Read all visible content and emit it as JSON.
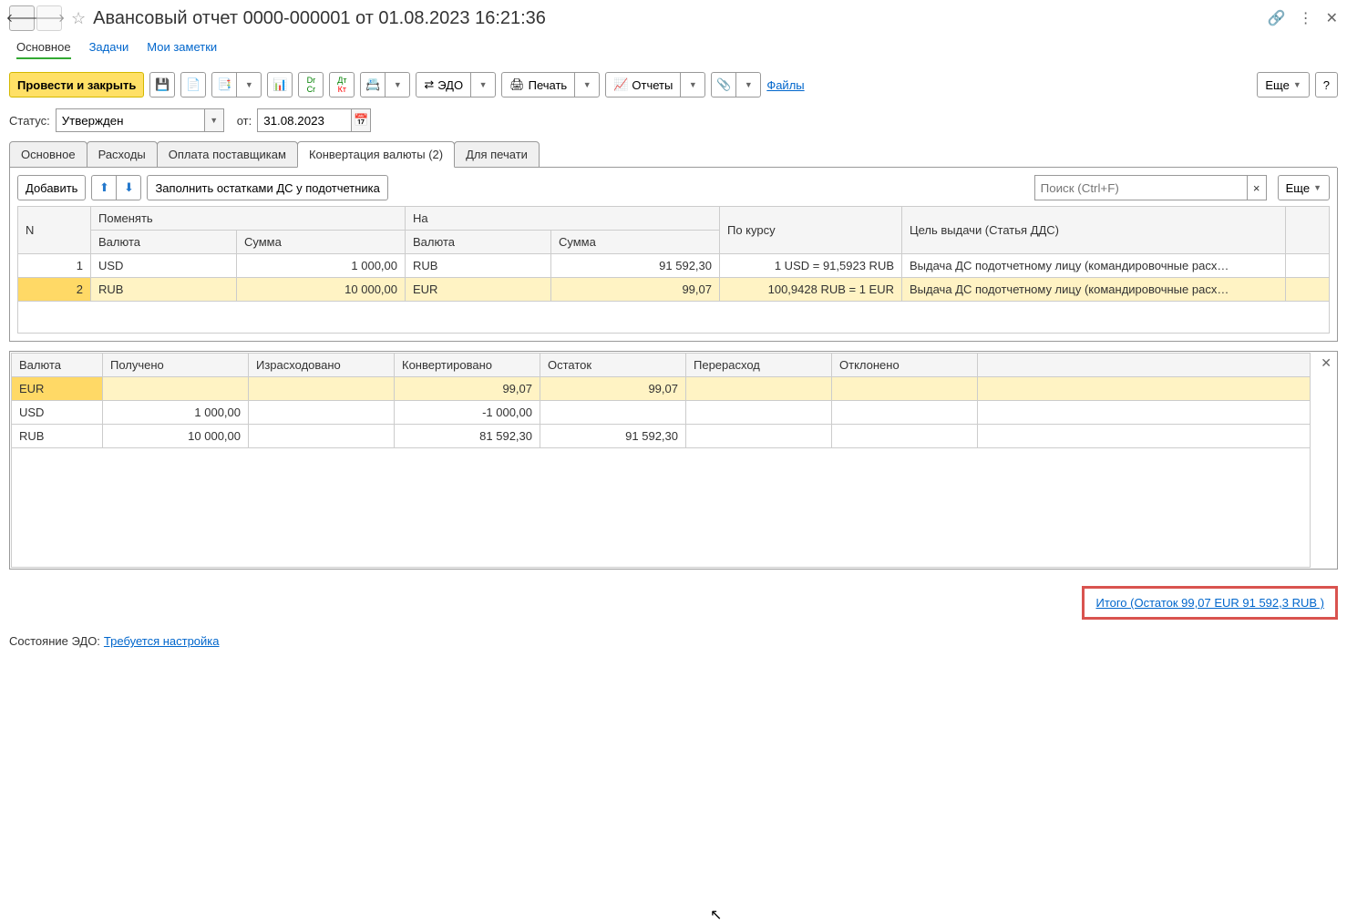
{
  "title": "Авансовый отчет 0000-000001 от 01.08.2023 16:21:36",
  "subtabs": {
    "main": "Основное",
    "tasks": "Задачи",
    "notes": "Мои заметки"
  },
  "toolbar": {
    "post_close": "Провести и закрыть",
    "edo": "ЭДО",
    "print": "Печать",
    "reports": "Отчеты",
    "files_link": "Файлы",
    "more": "Еще",
    "help": "?"
  },
  "status": {
    "label": "Статус:",
    "value": "Утвержден",
    "from_label": "от:",
    "from_date": "31.08.2023"
  },
  "tabs": {
    "t1": "Основное",
    "t2": "Расходы",
    "t3": "Оплата поставщикам",
    "t4": "Конвертация валюты (2)",
    "t5": "Для печати"
  },
  "conv_toolbar": {
    "add": "Добавить",
    "fill": "Заполнить остатками ДС у подотчетника",
    "search_ph": "Поиск (Ctrl+F)",
    "more": "Еще"
  },
  "grid": {
    "headers": {
      "n": "N",
      "from": "Поменять",
      "to": "На",
      "rate": "По курсу",
      "purpose": "Цель выдачи (Статья ДДС)",
      "currency": "Валюта",
      "sum": "Сумма"
    },
    "rows": [
      {
        "n": "1",
        "from_cur": "USD",
        "from_sum": "1 000,00",
        "to_cur": "RUB",
        "to_sum": "91 592,30",
        "rate": "1 USD = 91,5923 RUB",
        "purpose": "Выдача ДС подотчетному лицу (командировочные расх…"
      },
      {
        "n": "2",
        "from_cur": "RUB",
        "from_sum": "10 000,00",
        "to_cur": "EUR",
        "to_sum": "99,07",
        "rate": "100,9428 RUB = 1 EUR",
        "purpose": "Выдача ДС подотчетному лицу (командировочные расх…"
      }
    ]
  },
  "summary": {
    "headers": {
      "currency": "Валюта",
      "received": "Получено",
      "spent": "Израсходовано",
      "converted": "Конвертировано",
      "balance": "Остаток",
      "overspend": "Перерасход",
      "declined": "Отклонено"
    },
    "rows": [
      {
        "currency": "EUR",
        "received": "",
        "spent": "",
        "converted": "99,07",
        "balance": "99,07",
        "overspend": "",
        "declined": ""
      },
      {
        "currency": "USD",
        "received": "1 000,00",
        "spent": "",
        "converted": "-1 000,00",
        "balance": "",
        "overspend": "",
        "declined": ""
      },
      {
        "currency": "RUB",
        "received": "10 000,00",
        "spent": "",
        "converted": "81 592,30",
        "balance": "91 592,30",
        "overspend": "",
        "declined": ""
      }
    ]
  },
  "total_link": "Итого (Остаток 99,07 EUR 91 592,3 RUB )",
  "footer": {
    "label": "Состояние ЭДО:",
    "link": "Требуется настройка"
  }
}
